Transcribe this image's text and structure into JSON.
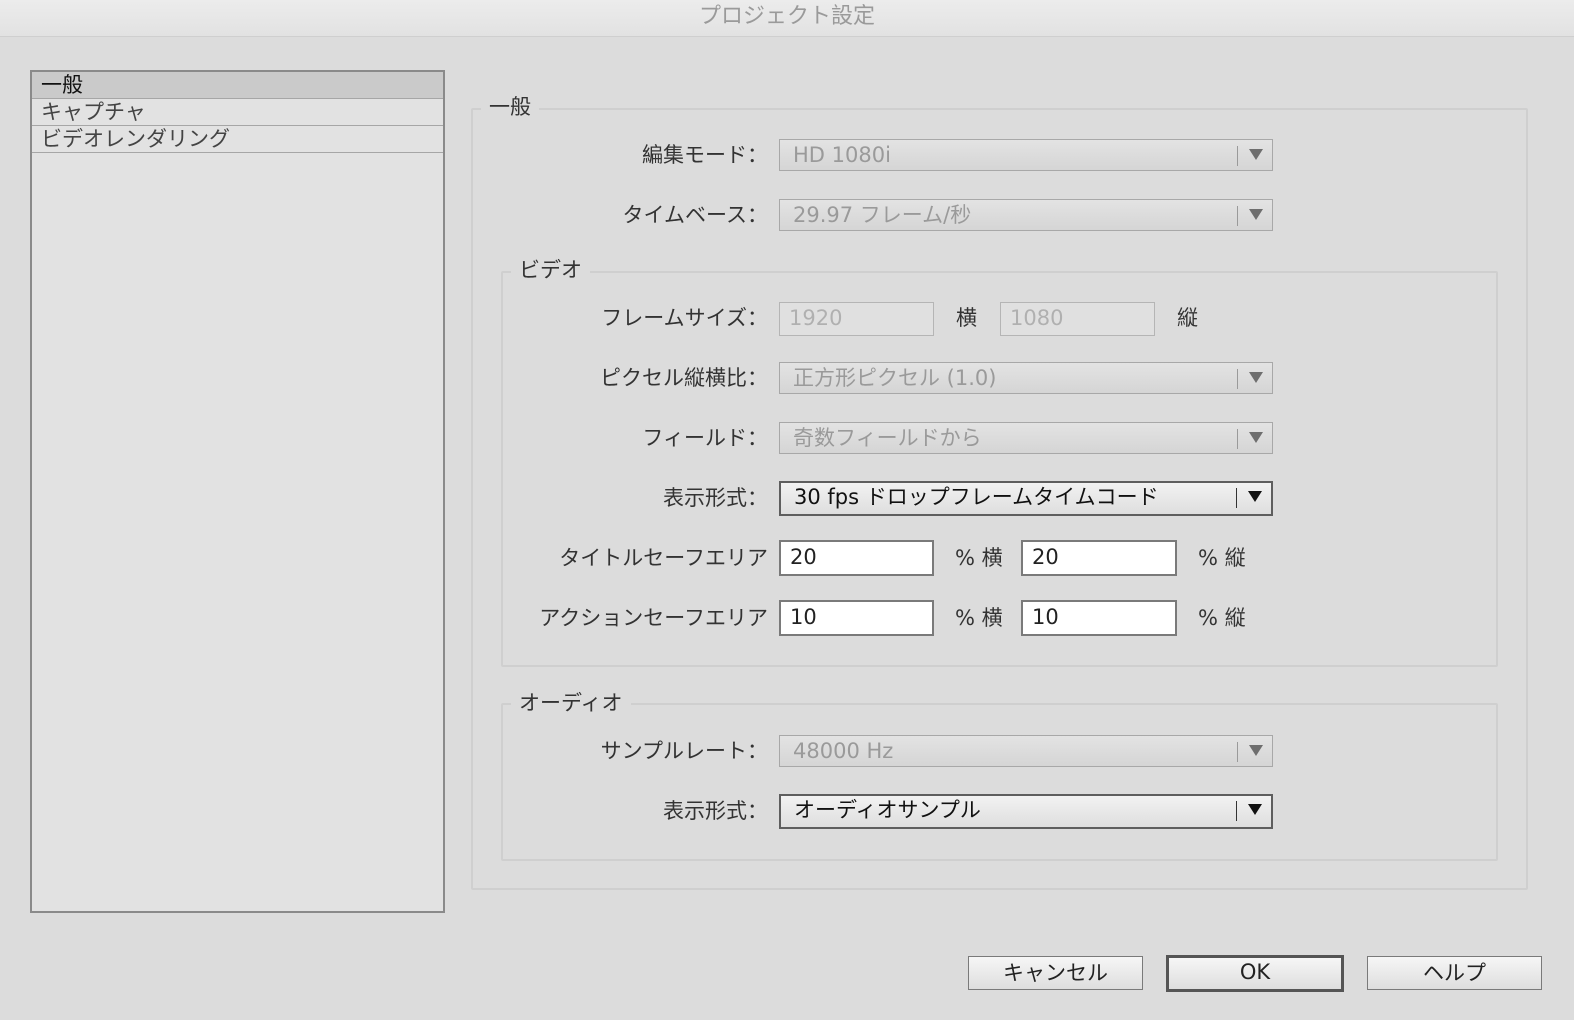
{
  "window": {
    "title": "プロジェクト設定"
  },
  "sidebar": {
    "items": [
      {
        "label": "一般",
        "selected": true
      },
      {
        "label": "キャプチャ",
        "selected": false
      },
      {
        "label": "ビデオレンダリング",
        "selected": false
      }
    ]
  },
  "general": {
    "legend": "一般",
    "editing_mode": {
      "label": "編集モード：",
      "value": "HD 1080i"
    },
    "timebase": {
      "label": "タイムベース：",
      "value": "29.97 フレーム/秒"
    }
  },
  "video": {
    "legend": "ビデオ",
    "frame_size": {
      "label": "フレームサイズ：",
      "width": "1920",
      "width_unit": "横",
      "height": "1080",
      "height_unit": "縦"
    },
    "pixel_aspect": {
      "label": "ピクセル縦横比：",
      "value": "正方形ピクセル (1.0)"
    },
    "fields": {
      "label": "フィールド：",
      "value": "奇数フィールドから"
    },
    "display_format": {
      "label": "表示形式：",
      "value": "30 fps ドロップフレームタイムコード"
    },
    "title_safe": {
      "label": "タイトルセーフエリア",
      "horizontal": "20",
      "horizontal_unit": "% 横",
      "vertical": "20",
      "vertical_unit": "% 縦"
    },
    "action_safe": {
      "label": "アクションセーフエリア",
      "horizontal": "10",
      "horizontal_unit": "% 横",
      "vertical": "10",
      "vertical_unit": "% 縦"
    }
  },
  "audio": {
    "legend": "オーディオ",
    "sample_rate": {
      "label": "サンプルレート：",
      "value": "48000 Hz"
    },
    "display_format": {
      "label": "表示形式：",
      "value": "オーディオサンプル"
    }
  },
  "buttons": {
    "cancel": "キャンセル",
    "ok": "OK",
    "help": "ヘルプ"
  },
  "icons": {
    "dropdown": "chevron-down-icon"
  }
}
